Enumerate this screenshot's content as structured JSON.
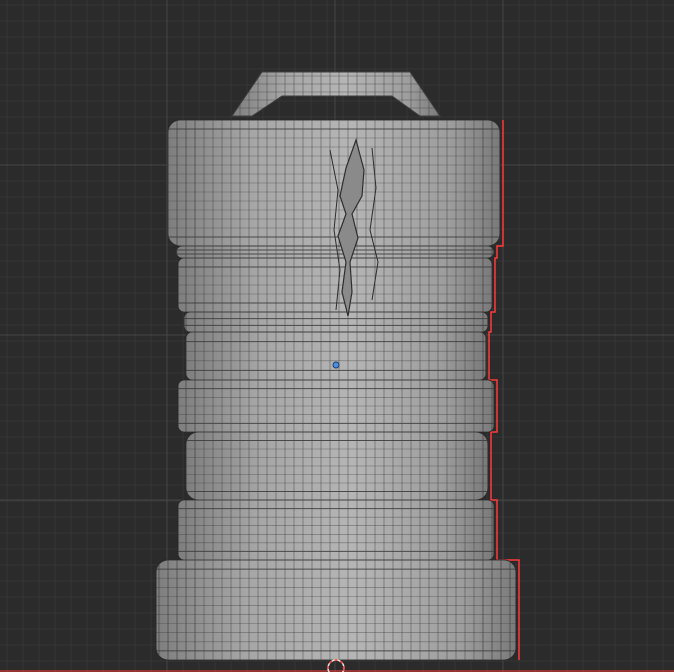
{
  "app": "3d-modeling-viewport",
  "viewport": {
    "background_color": "#2b2b2b",
    "grid_minor_color": "#363636",
    "grid_major_color": "#454545",
    "mesh_face_color": "#a9a9a9",
    "mesh_wire_color": "#3f3f3f",
    "selection_outline_color": "#ff3b3b",
    "origin_dot_color": "#4a8fe0"
  },
  "icons": {
    "origin": "object-origin-dot",
    "cursor": "3d-cursor-icon"
  }
}
